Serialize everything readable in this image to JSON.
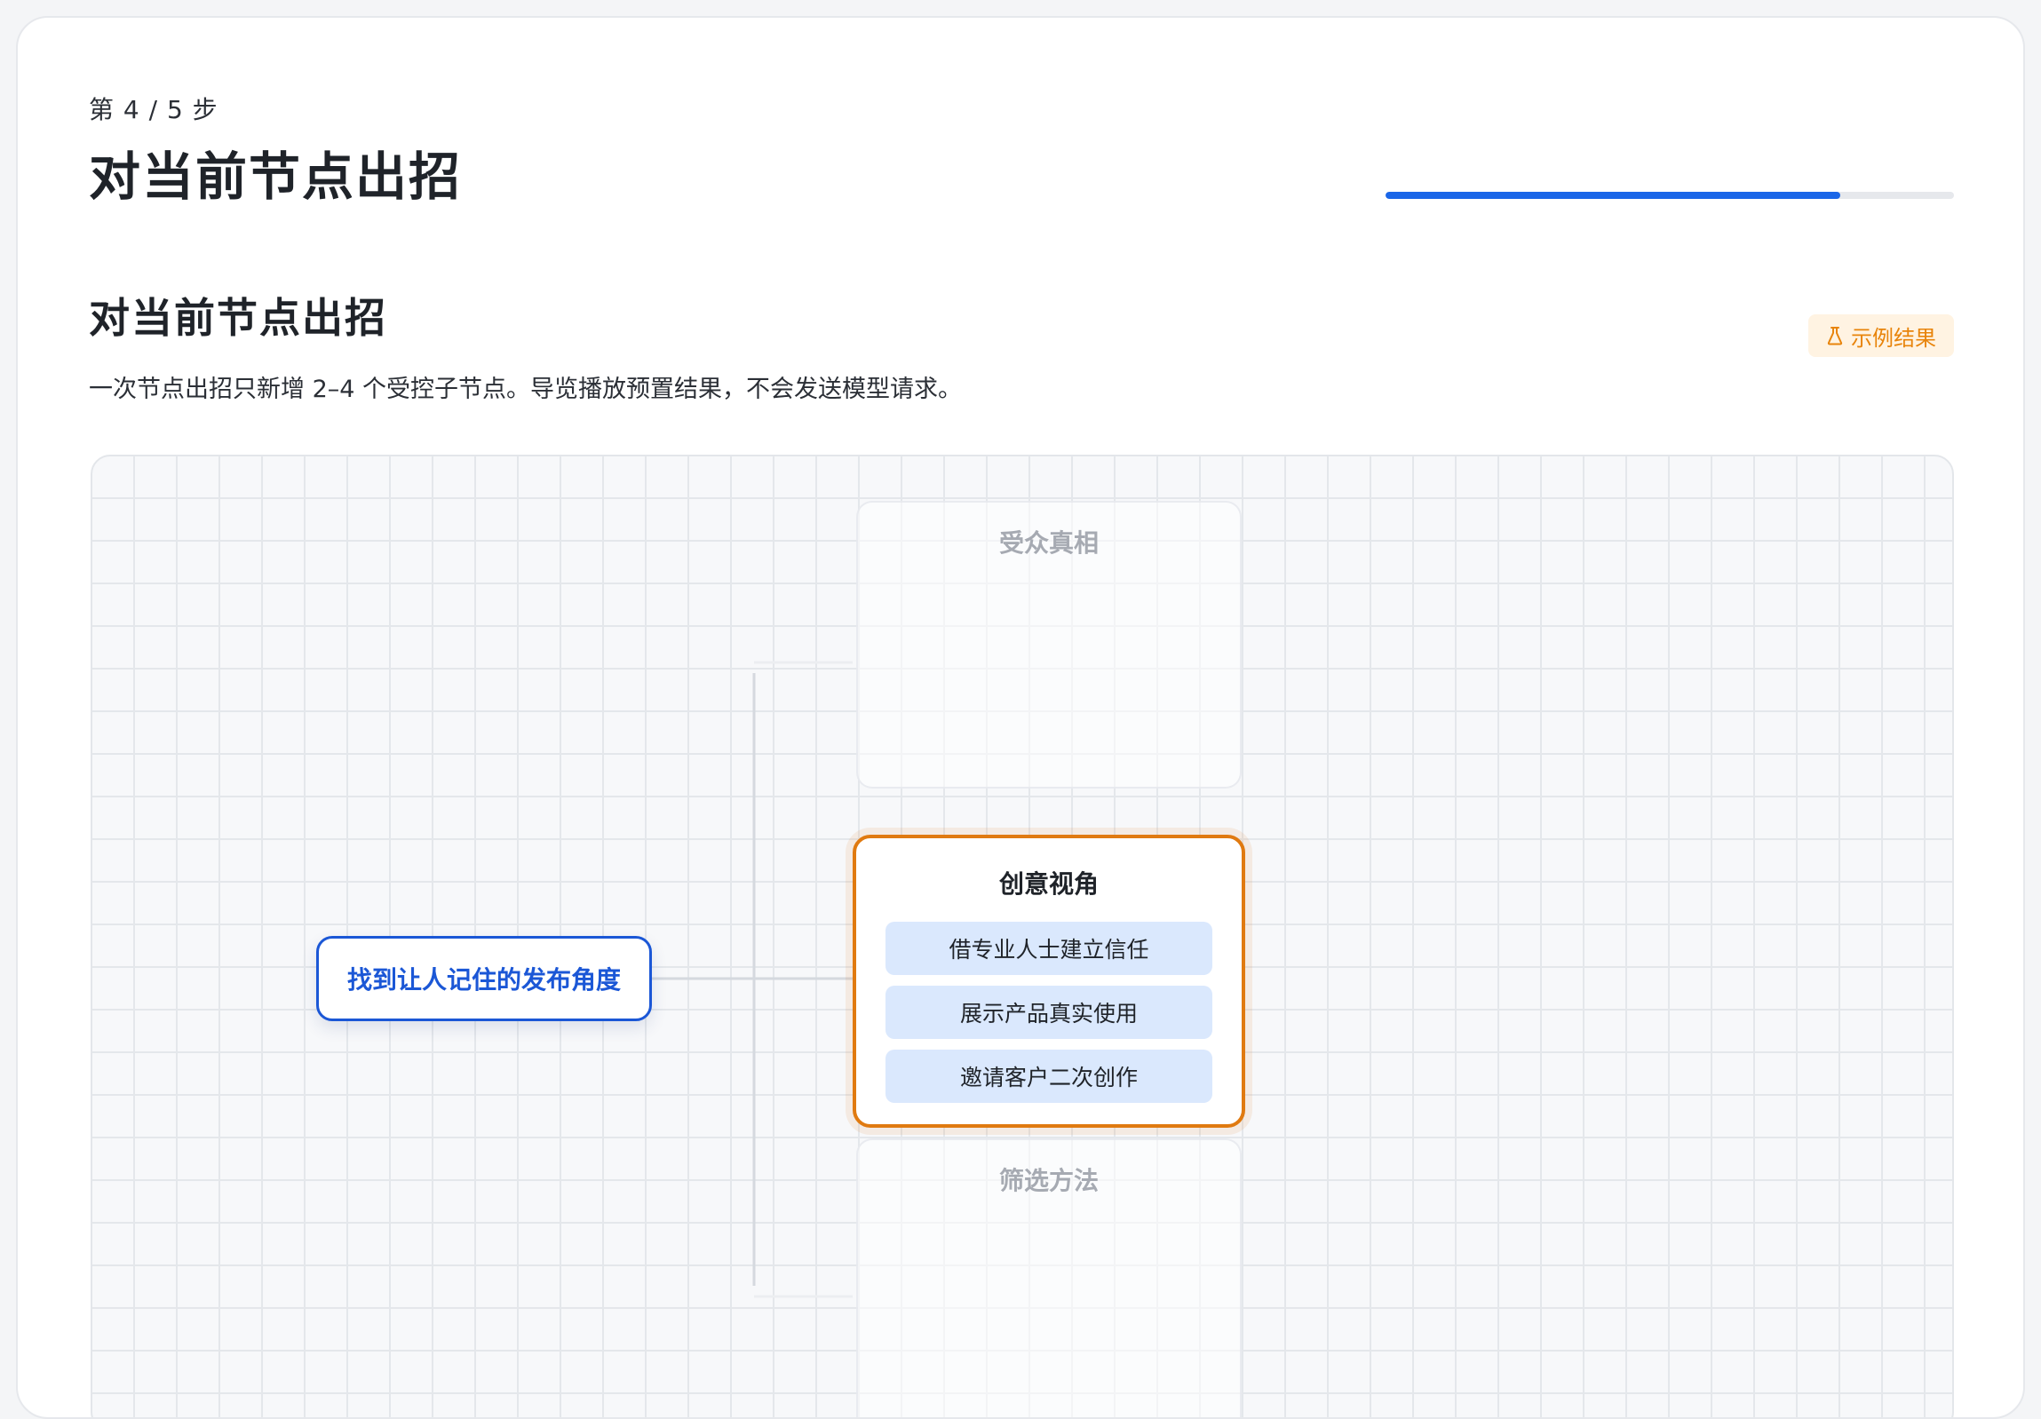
{
  "header": {
    "step_label": "第 4 / 5 步",
    "title": "对当前节点出招",
    "progress": 0.8
  },
  "section": {
    "title": "对当前节点出招",
    "description": "一次节点出招只新增 2–4 个受控子节点。导览播放预置结果，不会发送模型请求。",
    "badge_label": "示例结果",
    "badge_icon": "flask-icon"
  },
  "mindmap": {
    "root": {
      "label": "找到让人记住的发布角度"
    },
    "branches": [
      {
        "title": "受众真相",
        "state": "dimmed"
      },
      {
        "title": "创意视角",
        "state": "active",
        "children": [
          "借专业人士建立信任",
          "展示产品真实使用",
          "邀请客户二次创作"
        ]
      },
      {
        "title": "筛选方法",
        "state": "dimmed"
      }
    ]
  },
  "colors": {
    "accent": "#1a66e8",
    "root_border": "#1b57d6",
    "active_border": "#e07a10",
    "badge_text": "#e8840b",
    "badge_bg": "#fff3e2",
    "child_bg": "#dae8fd"
  }
}
